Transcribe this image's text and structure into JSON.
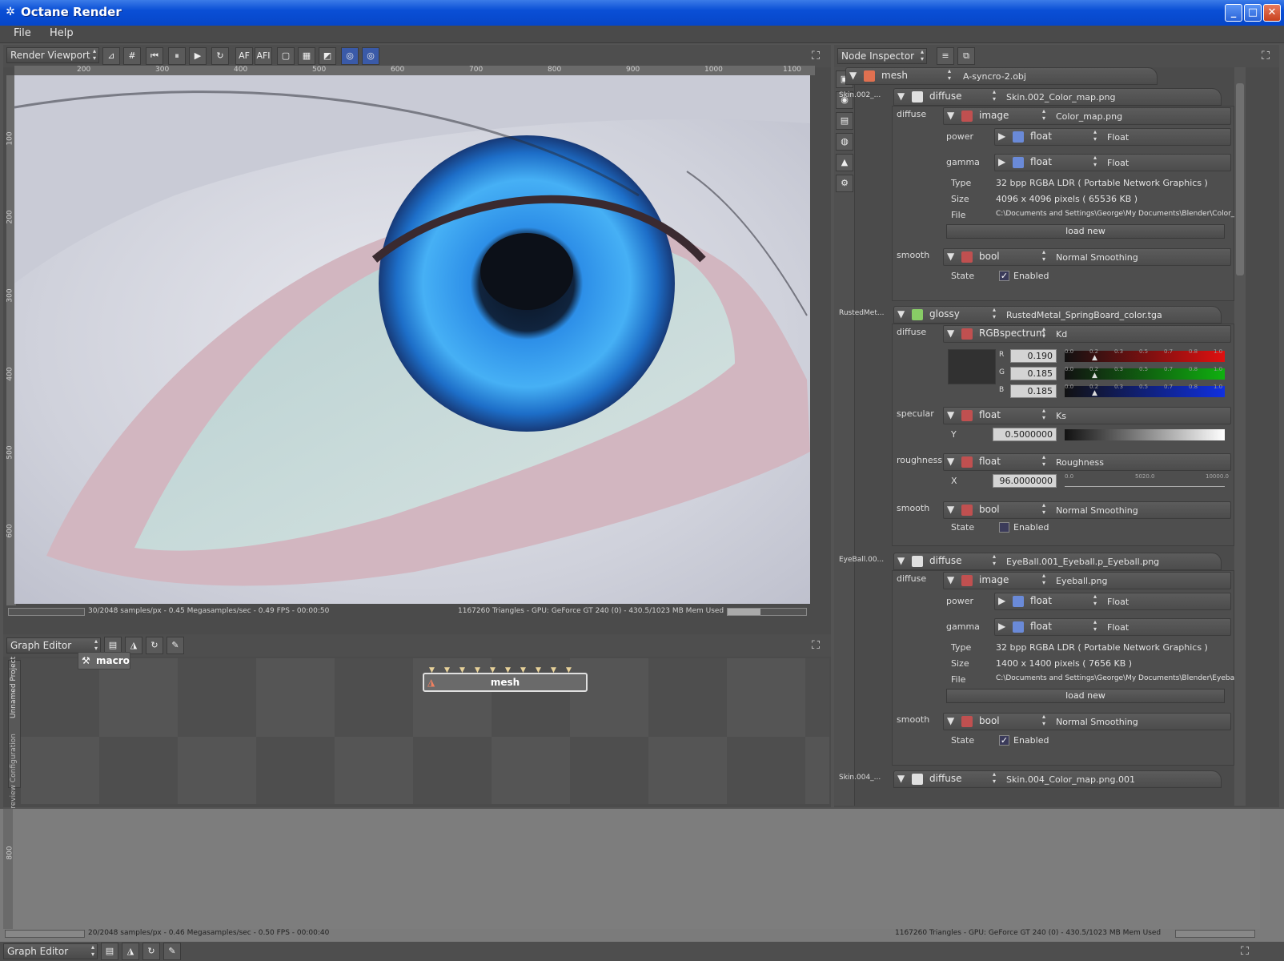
{
  "window": {
    "title": "Octane Render",
    "min": "_",
    "max": "□",
    "close": "✕",
    "icon": "gear-icon"
  },
  "menu": {
    "file": "File",
    "help": "Help"
  },
  "viewport": {
    "mode": "Render Viewport",
    "buttons": [
      "⊿",
      "#",
      "⏮",
      "⏸",
      "▶",
      "↻",
      "AF",
      "AFI",
      "▢",
      "▦",
      "◩",
      "◎",
      "◎"
    ],
    "ruler_h": [
      "200",
      "300",
      "400",
      "500",
      "600",
      "700",
      "800",
      "900",
      "1000",
      "1100"
    ],
    "ruler_v": [
      "100",
      "200",
      "300",
      "400",
      "500",
      "600"
    ],
    "status_left": "30/2048 samples/px - 0.45 Megasamples/sec - 0.49 FPS - 00:00:50",
    "status_right": "1167260 Triangles - GPU: GeForce GT 240 (0) - 430.5/1023 MB Mem Used",
    "mem_fraction": 0.42
  },
  "graph": {
    "title": "Graph Editor",
    "macro": "macro",
    "mesh": "mesh",
    "tab1": "Unnamed Project",
    "tab2": "Preview Configuration"
  },
  "inspector": {
    "title": "Node Inspector",
    "root_type": "mesh",
    "root_name": "A-syncro-2.obj",
    "mat1": {
      "side": "Skin.002_...",
      "type": "diffuse",
      "name": "Skin.002_Color_map.png",
      "diffuse_lbl": "diffuse",
      "img_type": "image",
      "img_name": "Color_map.png",
      "power_lbl": "power",
      "power_type": "float",
      "power_val": "Float",
      "gamma_lbl": "gamma",
      "gamma_type": "float",
      "gamma_val": "Float",
      "type_lbl": "Type",
      "type_val": "32 bpp RGBA LDR ( Portable Network Graphics )",
      "size_lbl": "Size",
      "size_val": "4096 x 4096 pixels ( 65536 KB )",
      "file_lbl": "File",
      "file_val": "C:\\Documents and Settings\\George\\My Documents\\Blender\\Color_map.png",
      "load": "load new",
      "smooth_lbl": "smooth",
      "smooth_type": "bool",
      "smooth_val": "Normal Smoothing",
      "state_lbl": "State",
      "state_val": "Enabled",
      "state_checked": "✓"
    },
    "mat2": {
      "side": "RustedMet...",
      "type": "glossy",
      "name": "RustedMetal_SpringBoard_color.tga",
      "diffuse_lbl": "diffuse",
      "rgb_type": "RGBspectrum",
      "rgb_name": "Kd",
      "r_lbl": "R",
      "r": "0.190",
      "g_lbl": "G",
      "g": "0.185",
      "b_lbl": "B",
      "b": "0.185",
      "slider_ticks": [
        "0.0",
        "0.2",
        "0.3",
        "0.5",
        "0.7",
        "0.8",
        "1.0"
      ],
      "spec_lbl": "specular",
      "spec_type": "float",
      "spec_name": "Ks",
      "y_lbl": "Y",
      "y_val": "0.5000000",
      "rough_lbl": "roughness",
      "rough_type": "float",
      "rough_name": "Roughness",
      "x_lbl": "X",
      "x_val": "96.0000000",
      "rough_ticks": [
        "0.0",
        "5020.0",
        "10000.0"
      ],
      "smooth_lbl": "smooth",
      "smooth_type": "bool",
      "smooth_val": "Normal Smoothing",
      "state_lbl": "State",
      "state_val": "Enabled"
    },
    "mat3": {
      "side": "EyeBall.00...",
      "type": "diffuse",
      "name": "EyeBall.001_Eyeball.p_Eyeball.png",
      "diffuse_lbl": "diffuse",
      "img_type": "image",
      "img_name": "Eyeball.png",
      "power_lbl": "power",
      "power_type": "float",
      "power_val": "Float",
      "gamma_lbl": "gamma",
      "gamma_type": "float",
      "gamma_val": "Float",
      "type_lbl": "Type",
      "type_val": "32 bpp RGBA LDR ( Portable Network Graphics )",
      "size_lbl": "Size",
      "size_val": "1400 x 1400 pixels ( 7656 KB )",
      "file_lbl": "File",
      "file_val": "C:\\Documents and Settings\\George\\My Documents\\Blender\\Eyeball.png",
      "load": "load new",
      "smooth_lbl": "smooth",
      "smooth_type": "bool",
      "smooth_val": "Normal Smoothing",
      "state_lbl": "State",
      "state_val": "Enabled",
      "state_checked": "✓"
    },
    "mat4": {
      "side": "Skin.004_...",
      "type": "diffuse",
      "name": "Skin.004_Color_map.png.001"
    }
  },
  "bottom": {
    "ruler_v": "800",
    "status_left": "20/2048 samples/px - 0.46 Megasamples/sec - 0.50 FPS - 00:00:40",
    "status_right": "1167260 Triangles - GPU: GeForce GT 240 (0) - 430.5/1023 MB Mem Used",
    "graph_title": "Graph Editor"
  },
  "colors": {
    "titlebar": "#0a4fd6",
    "panel": "#4b4b4b",
    "iris": "#2a8be0"
  }
}
